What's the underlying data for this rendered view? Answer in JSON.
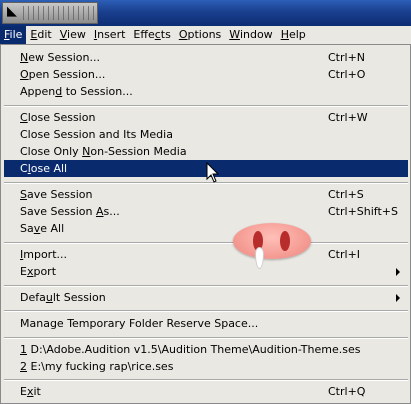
{
  "menubar": {
    "items": [
      {
        "label": "File",
        "u": "F",
        "rest": "ile"
      },
      {
        "label": "Edit",
        "u": "E",
        "rest": "dit"
      },
      {
        "label": "View",
        "u": "V",
        "rest": "iew"
      },
      {
        "label": "Insert",
        "u": "I",
        "rest": "nsert"
      },
      {
        "label": "Effects",
        "pre": "Effe",
        "u": "c",
        "rest": "ts"
      },
      {
        "label": "Options",
        "u": "O",
        "rest": "ptions"
      },
      {
        "label": "Window",
        "u": "W",
        "rest": "indow"
      },
      {
        "label": "Help",
        "u": "H",
        "rest": "elp"
      }
    ]
  },
  "file_menu": {
    "new_session": {
      "u": "N",
      "rest": "ew Session...",
      "shortcut": "Ctrl+N"
    },
    "open_session": {
      "u": "O",
      "rest": "pen Session...",
      "shortcut": "Ctrl+O"
    },
    "append_session": {
      "pre": "Appen",
      "u": "d",
      "rest": " to Session..."
    },
    "close_session": {
      "u": "C",
      "rest": "lose Session",
      "shortcut": "Ctrl+W"
    },
    "close_session_media": "Close Session and Its Media",
    "close_non_session": {
      "pre": "Close Only ",
      "u": "N",
      "rest": "on-Session Media"
    },
    "close_all": {
      "pre": "C",
      "u": "l",
      "rest": "ose All"
    },
    "save_session": {
      "u": "S",
      "rest": "ave Session",
      "shortcut": "Ctrl+S"
    },
    "save_session_as": {
      "pre": "Save Session ",
      "u": "A",
      "rest": "s...",
      "shortcut": "Ctrl+Shift+S"
    },
    "save_all": {
      "pre": "Sa",
      "u": "v",
      "rest": "e All"
    },
    "import": {
      "u": "I",
      "rest": "mport...",
      "shortcut": "Ctrl+I"
    },
    "export": {
      "pre": "E",
      "u": "x",
      "rest": "port"
    },
    "default_session": {
      "pre": "Defa",
      "u": "u",
      "rest": "lt Session"
    },
    "manage_temp": "Manage Temporary Folder Reserve Space...",
    "recent_1": {
      "u": "1",
      "rest": " D:\\Adobe.Audition v1.5\\Audition Theme\\Audition-Theme.ses"
    },
    "recent_2": {
      "u": "2",
      "rest": " E:\\my fucking rap\\rice.ses"
    },
    "exit": {
      "pre": "E",
      "u": "x",
      "rest": "it",
      "shortcut": "Ctrl+Q"
    }
  },
  "icons": {
    "app": "audition-app-icon",
    "cursor": "mouse-pointer-icon",
    "sticker": "pig-snout-sticker",
    "submenu": "submenu-arrow-icon"
  }
}
